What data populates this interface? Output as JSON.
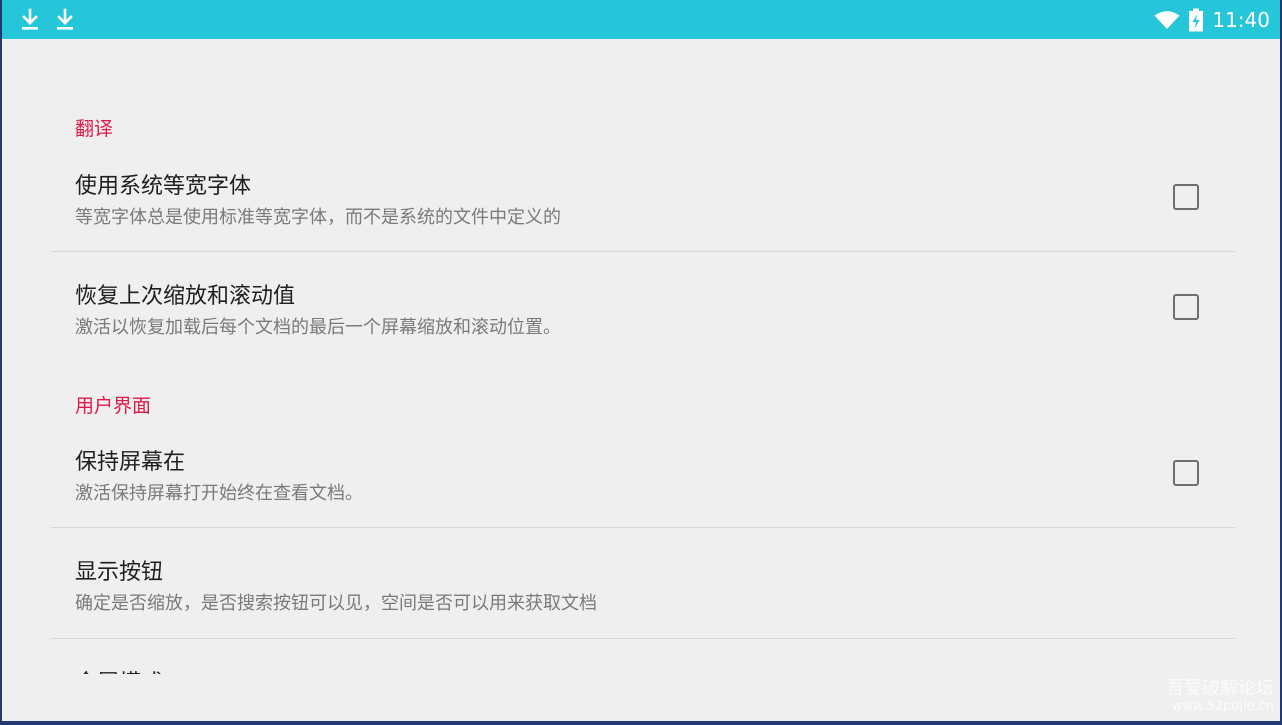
{
  "status_bar": {
    "time": "11:40",
    "icons": [
      "download-icon",
      "download-icon",
      "wifi-icon",
      "battery-charging-icon"
    ]
  },
  "categories": {
    "translation": "翻译",
    "user_interface": "用户界面"
  },
  "prefs": [
    {
      "title": "使用系统等宽字体",
      "summary": "等宽字体总是使用标准等宽字体，而不是系统的文件中定义的",
      "checked": false
    },
    {
      "title": "恢复上次缩放和滚动值",
      "summary": "激活以恢复加载后每个文档的最后一个屏幕缩放和滚动位置。",
      "checked": false
    },
    {
      "title": "保持屏幕在",
      "summary": "激活保持屏幕打开始终在查看文档。",
      "checked": false
    },
    {
      "title": "显示按钮",
      "summary": "确定是否缩放，是否搜索按钮可以见，空间是否可以用来获取文档"
    },
    {
      "title": "全屏模式"
    }
  ],
  "watermark": {
    "name": "吾爱破解论坛",
    "url": "www.52pojie.cn"
  },
  "colors": {
    "status_bar": "#26c6da",
    "accent": "#e0194a",
    "background": "#efefef"
  }
}
